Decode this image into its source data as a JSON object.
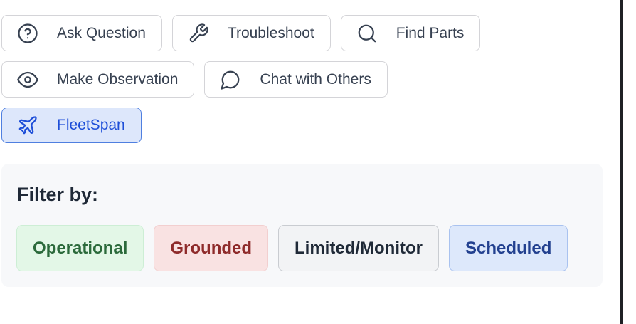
{
  "actions": {
    "ask_question": {
      "label": "Ask Question",
      "icon": "question-circle-icon"
    },
    "troubleshoot": {
      "label": "Troubleshoot",
      "icon": "wrench-icon"
    },
    "find_parts": {
      "label": "Find Parts",
      "icon": "search-icon"
    },
    "make_observation": {
      "label": "Make Observation",
      "icon": "eye-icon"
    },
    "chat_with_others": {
      "label": "Chat with Others",
      "icon": "chat-bubble-icon"
    },
    "fleetspan": {
      "label": "FleetSpan",
      "icon": "airplane-icon",
      "active": true
    }
  },
  "filter": {
    "title": "Filter by:",
    "chips": [
      {
        "label": "Operational",
        "color": "#2b6a3b",
        "bg": "#e3f7e7"
      },
      {
        "label": "Grounded",
        "color": "#8e2a2a",
        "bg": "#f9e2e2"
      },
      {
        "label": "Limited/Monitor",
        "color": "#1f2937",
        "bg": "#f2f3f5"
      },
      {
        "label": "Scheduled",
        "color": "#22408f",
        "bg": "#dde8fb"
      }
    ]
  },
  "colors": {
    "accent": "#1d4ed8",
    "button_border": "#d4d4d8",
    "panel_bg": "#f7f8fa"
  }
}
